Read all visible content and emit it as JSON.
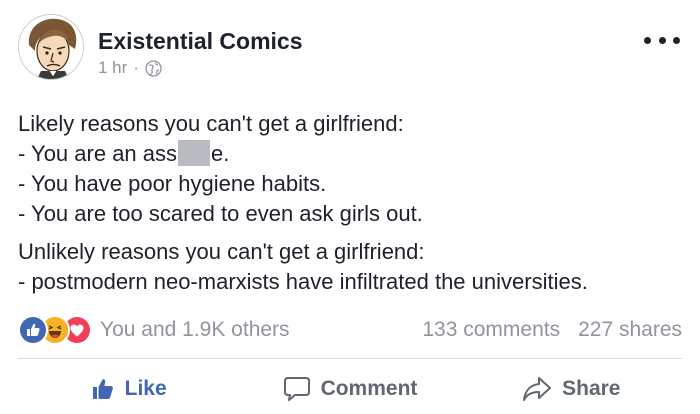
{
  "post": {
    "author": "Existential Comics",
    "time": "1 hr",
    "separator": "·",
    "paragraphs": [
      {
        "lines": [
          {
            "text": "Likely reasons you can't get a girlfriend:"
          },
          {
            "pre": "- You are an ass",
            "post": "e.",
            "redacted": true
          },
          {
            "text": "- You have poor hygiene habits."
          },
          {
            "text": "- You are too scared to even ask girls out."
          }
        ]
      },
      {
        "lines": [
          {
            "text": "Unlikely reasons you can't get a girlfriend:"
          },
          {
            "text": "- postmodern neo-marxists have infiltrated the universities."
          }
        ]
      }
    ]
  },
  "stats": {
    "reactions": [
      "like",
      "haha",
      "love"
    ],
    "reaction_summary": "You and 1.9K others",
    "comments": "133 comments",
    "shares": "227 shares"
  },
  "actions": {
    "like_label": "Like",
    "comment_label": "Comment",
    "share_label": "Share"
  },
  "colors": {
    "like_blue": "#4267b2",
    "love_red": "#f33e58",
    "haha_yellow": "#f7b125",
    "muted_text": "#90949c",
    "redaction": "#b8bbc0"
  },
  "icons": {
    "avatar": "cartoon-philosopher-avatar",
    "audience": "globe-icon",
    "more": "more-options-icon",
    "like": "thumbs-up-icon",
    "comment": "speech-bubble-icon",
    "share": "share-arrow-icon"
  }
}
